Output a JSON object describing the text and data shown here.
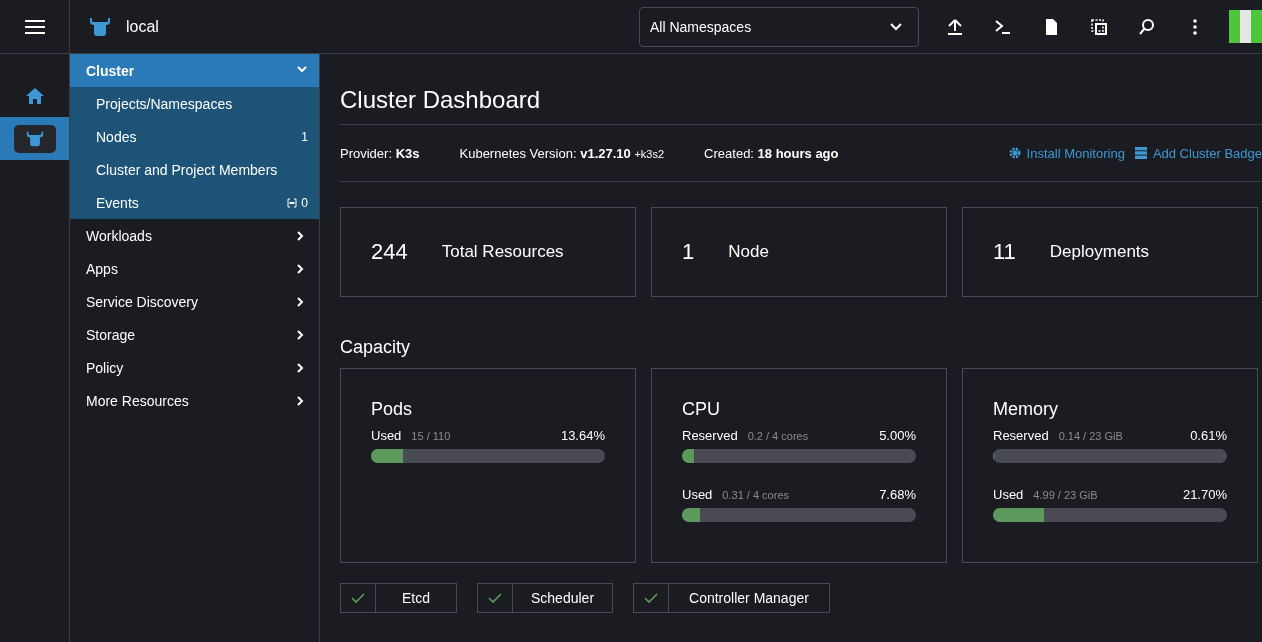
{
  "topbar": {
    "cluster_name": "local",
    "namespace_select": "All Namespaces"
  },
  "rail": [
    {
      "kind": "home",
      "selected": false
    },
    {
      "kind": "cluster",
      "selected": true
    }
  ],
  "sidebar": [
    {
      "label": "Cluster",
      "expanded": true,
      "children": [
        {
          "label": "Projects/Namespaces"
        },
        {
          "label": "Nodes",
          "count": "1"
        },
        {
          "label": "Cluster and Project Members"
        },
        {
          "label": "Events",
          "count": "0",
          "kind": "events"
        }
      ]
    },
    {
      "label": "Workloads",
      "expanded": false
    },
    {
      "label": "Apps",
      "expanded": false
    },
    {
      "label": "Service Discovery",
      "expanded": false
    },
    {
      "label": "Storage",
      "expanded": false
    },
    {
      "label": "Policy",
      "expanded": false
    },
    {
      "label": "More Resources",
      "expanded": false
    }
  ],
  "dashboard": {
    "title": "Cluster Dashboard",
    "info": [
      {
        "label": "Provider:",
        "value": "K3s"
      },
      {
        "label": "Kubernetes Version:",
        "value": "v1.27.10",
        "suffix": "+k3s2"
      },
      {
        "label": "Created:",
        "value": "18 hours ago"
      }
    ],
    "actions": [
      {
        "kind": "gear",
        "label": "Install Monitoring"
      },
      {
        "kind": "badge",
        "label": "Add Cluster Badge"
      }
    ],
    "counts": [
      {
        "value": "244",
        "label": "Total Resources"
      },
      {
        "value": "1",
        "label": "Node"
      },
      {
        "value": "11",
        "label": "Deployments"
      }
    ],
    "capacity_title": "Capacity",
    "capacity": [
      {
        "title": "Pods",
        "meters": [
          {
            "label": "Used",
            "detail": "15 / 110",
            "reading": "13.64%",
            "level": 0.1364
          }
        ]
      },
      {
        "title": "CPU",
        "meters": [
          {
            "label": "Reserved",
            "detail": "0.2 / 4 cores",
            "reading": "5.00%",
            "level": 0.05
          },
          {
            "label": "Used",
            "detail": "0.31 / 4 cores",
            "reading": "7.68%",
            "level": 0.0768
          }
        ]
      },
      {
        "title": "Memory",
        "meters": [
          {
            "label": "Reserved",
            "detail": "0.14 / 23 GiB",
            "reading": "0.61%",
            "level": 0.0061
          },
          {
            "label": "Used",
            "detail": "4.99 / 23 GiB",
            "reading": "21.70%",
            "level": 0.217
          }
        ]
      }
    ],
    "components": [
      {
        "label": "Etcd",
        "healthy": true
      },
      {
        "label": "Scheduler",
        "healthy": true
      },
      {
        "label": "Controller Manager",
        "healthy": true
      }
    ]
  }
}
